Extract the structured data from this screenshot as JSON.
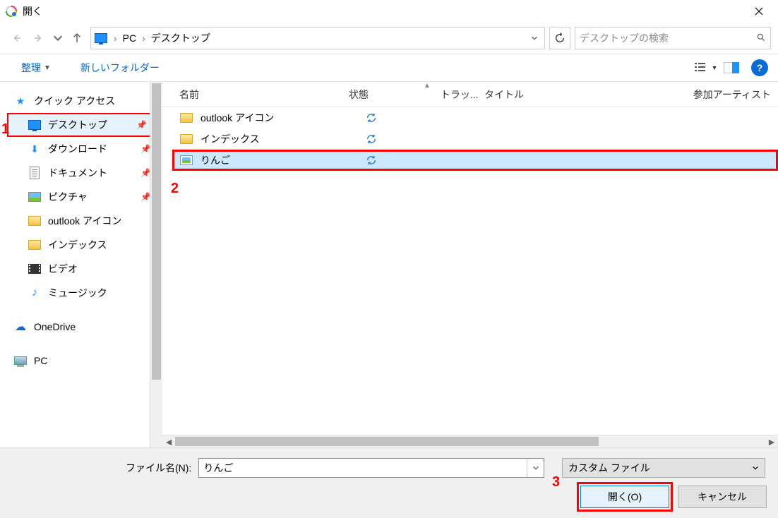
{
  "title": "開く",
  "breadcrumb": {
    "root": "PC",
    "folder": "デスクトップ"
  },
  "search_placeholder": "デスクトップの検索",
  "toolbar": {
    "organize": "整理",
    "new_folder": "新しいフォルダー"
  },
  "help_symbol": "?",
  "columns": {
    "name": "名前",
    "state": "状態",
    "track": "トラッ...",
    "title": "タイトル",
    "artist": "参加アーティスト"
  },
  "nav": {
    "quick_access": "クイック アクセス",
    "desktop": "デスクトップ",
    "downloads": "ダウンロード",
    "documents": "ドキュメント",
    "pictures": "ピクチャ",
    "outlook_icons": "outlook アイコン",
    "index": "インデックス",
    "videos": "ビデオ",
    "music": "ミュージック",
    "onedrive": "OneDrive",
    "pc": "PC"
  },
  "files": [
    {
      "name": "outlook アイコン",
      "type": "folder",
      "state": "sync"
    },
    {
      "name": "インデックス",
      "type": "folder",
      "state": "sync"
    },
    {
      "name": "りんご",
      "type": "image",
      "state": "sync",
      "selected": true
    }
  ],
  "footer": {
    "filename_label": "ファイル名(N):",
    "filename_value": "りんご",
    "filter": "カスタム ファイル",
    "open": "開く(O)",
    "cancel": "キャンセル"
  },
  "annotations": {
    "a1": "1",
    "a2": "2",
    "a3": "3"
  }
}
